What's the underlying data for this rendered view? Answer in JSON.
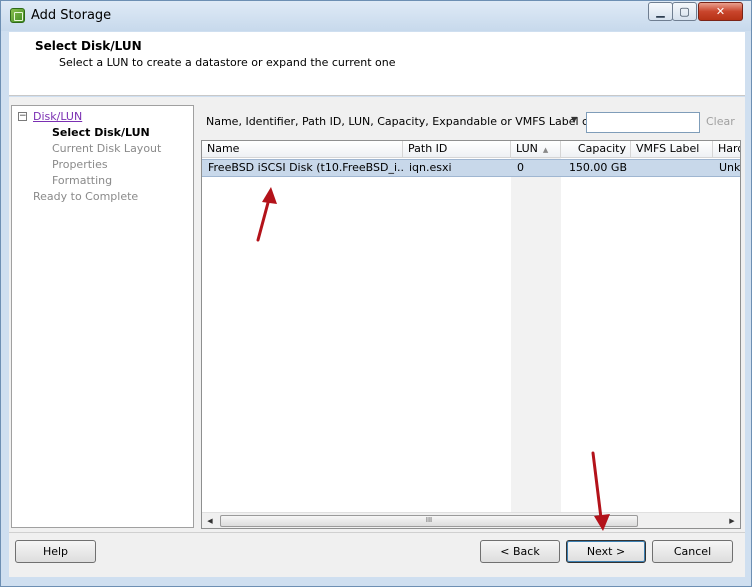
{
  "window": {
    "title": "Add Storage",
    "controls": {
      "minimize": "▁",
      "maximize": "▢",
      "close": "✕"
    }
  },
  "header": {
    "title": "Select Disk/LUN",
    "subtitle": "Select a LUN to create a datastore or expand the current one"
  },
  "nav": {
    "toggle": "−",
    "items": [
      {
        "label": "Disk/LUN",
        "state": "link"
      },
      {
        "label": "Select Disk/LUN",
        "state": "active"
      },
      {
        "label": "Current Disk Layout",
        "state": "muted"
      },
      {
        "label": "Properties",
        "state": "muted"
      },
      {
        "label": "Formatting",
        "state": "muted"
      },
      {
        "label": "Ready to Complete",
        "state": "muted"
      }
    ]
  },
  "filter": {
    "label": "Name, Identifier, Path ID, LUN, Capacity, Expandable or VMFS Label c...",
    "dropdown_icon": "▼",
    "value": "",
    "clear_label": "Clear"
  },
  "table": {
    "columns": [
      "Name",
      "Path ID",
      "LUN",
      "Capacity",
      "VMFS Label",
      "Hard"
    ],
    "sort_indicator": "▲",
    "rows": [
      {
        "name": "FreeBSD iSCSI Disk (t10.FreeBSD_i...",
        "path_id": "iqn.esxi",
        "lun": "0",
        "capacity": "150.00 GB",
        "vmfs_label": "",
        "hard": "Unk"
      }
    ]
  },
  "scrollbar": {
    "left": "◀",
    "right": "▶",
    "grip": "III"
  },
  "footer": {
    "help": "Help",
    "back": "< Back",
    "next": "Next >",
    "cancel": "Cancel"
  },
  "colors": {
    "annotation_arrow": "#b3121a",
    "selection": "#c8d8ea"
  }
}
